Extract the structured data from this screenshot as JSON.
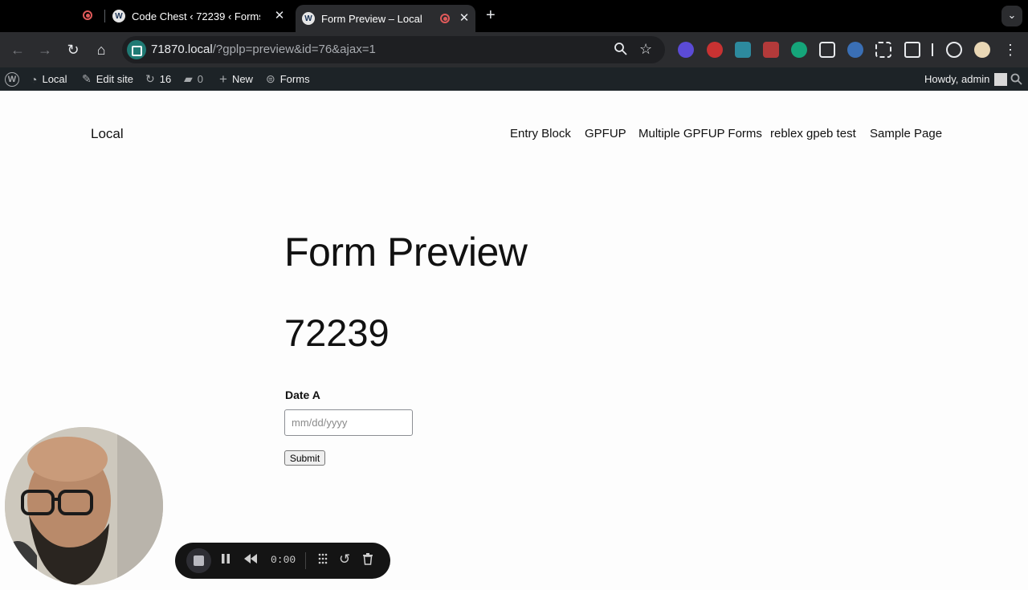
{
  "browser": {
    "tabs": [
      {
        "title": "Code Chest ‹ 72239 ‹ Forms",
        "active": false
      },
      {
        "title": "Form Preview – Local",
        "active": true
      }
    ],
    "new_tab_label": "+",
    "url_host": "71870.local",
    "url_path": "/?gplp=preview&id=76&ajax=1",
    "close_glyph": "✕",
    "menu_glyph": "⌄"
  },
  "adminbar": {
    "wp_logo": "W",
    "site_name": "Local",
    "edit_site": "Edit site",
    "updates_count": "16",
    "comments_count": "0",
    "new_label": "New",
    "forms_label": "Forms",
    "greeting": "Howdy, admin"
  },
  "site": {
    "title": "Local",
    "nav": [
      "Entry Block",
      "GPFUP",
      "Multiple GPFUP Forms",
      "reblex gpeb test",
      "Sample Page"
    ]
  },
  "main": {
    "page_title": "Form Preview",
    "form_title": "72239",
    "field_label": "Date A",
    "date_placeholder": "mm/dd/yyyy",
    "submit_label": "Submit"
  },
  "recorder": {
    "timer": "0:00"
  },
  "colors": {
    "tabstrip": "#000000",
    "toolbar": "#2b2c2f",
    "adminbar": "#1d2327",
    "site_chip": "#1f7a74",
    "record_red": "#e05a5a"
  }
}
